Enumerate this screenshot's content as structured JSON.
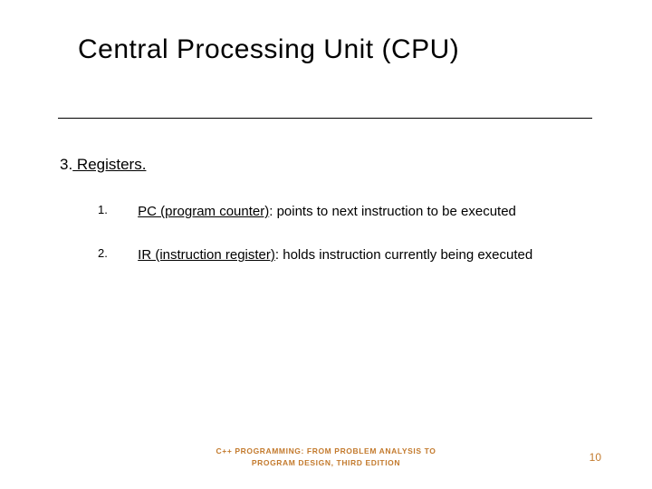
{
  "title": "Central Processing Unit (CPU)",
  "section": {
    "number": "3.",
    "label": " Registers."
  },
  "items": [
    {
      "num": "1.",
      "term": "PC (program counter)",
      "desc": ": points to next instruction to be executed"
    },
    {
      "num": "2.",
      "term": "IR (instruction register)",
      "desc": ": holds instruction currently being executed"
    }
  ],
  "footer": {
    "line1": "C++ PROGRAMMING: FROM PROBLEM ANALYSIS TO",
    "line2": "PROGRAM DESIGN, THIRD EDITION"
  },
  "page_number": "10"
}
